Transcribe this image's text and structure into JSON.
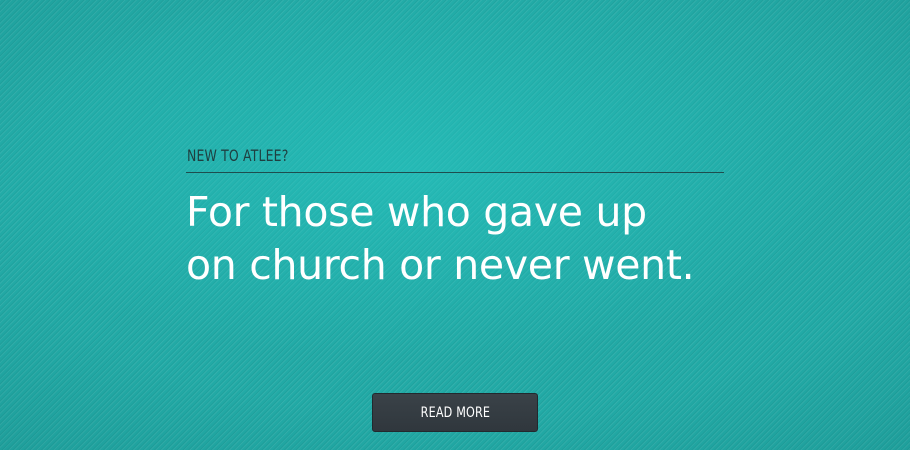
{
  "hero": {
    "eyebrow": "NEW TO ATLEE?",
    "headline_line1": "For those who gave up",
    "headline_line2": "on church or never went.",
    "button_label": "READ MORE"
  },
  "colors": {
    "background": "#22aaa6",
    "eyebrow_text": "#1f3f40",
    "headline_text": "#ffffff",
    "button_bg": "#30373d",
    "button_text": "#ffffff"
  }
}
